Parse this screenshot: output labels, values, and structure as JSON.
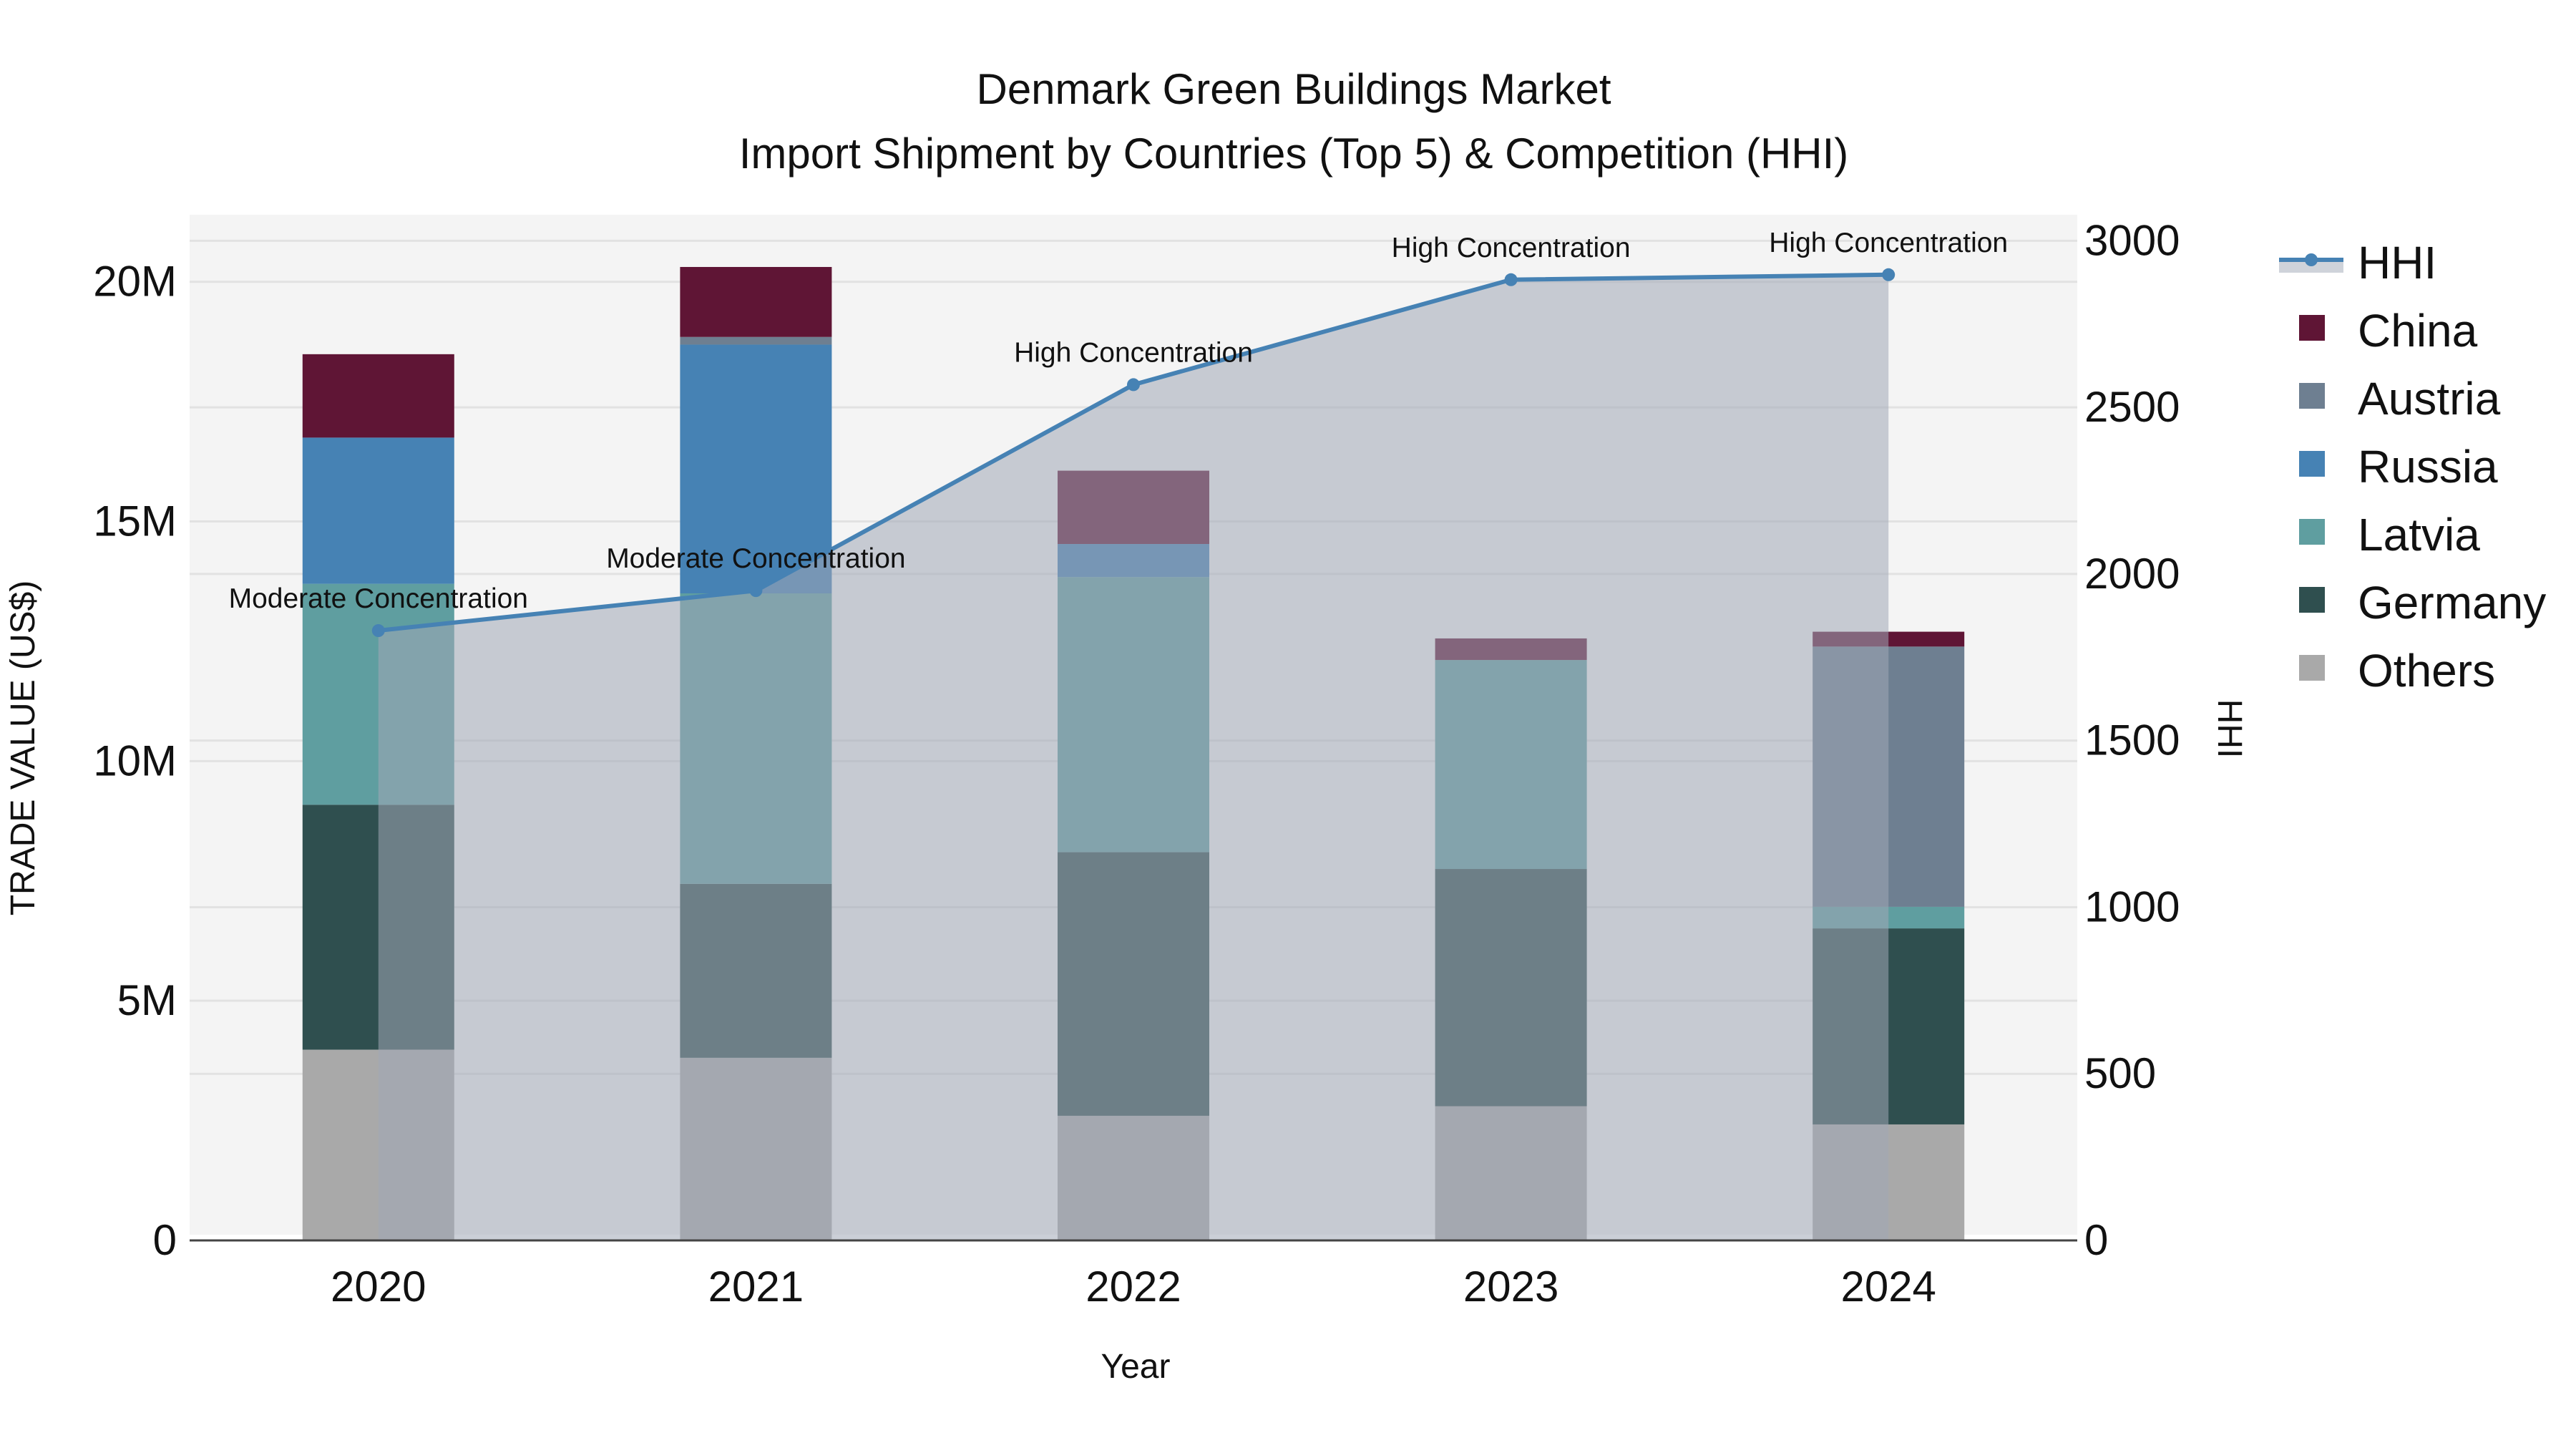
{
  "chart_data": {
    "type": "bar",
    "stacked": true,
    "title": "Denmark Green Buildings Market",
    "subtitle": "Import Shipment by Countries (Top 5) & Competition (HHI)",
    "xlabel": "Year",
    "ylabel": "TRADE VALUE (US$)",
    "y2label": "HHI",
    "categories": [
      "2020",
      "2021",
      "2022",
      "2023",
      "2024"
    ],
    "ylim": [
      0,
      21.4
    ],
    "y_unit": "M US$",
    "yticks": [
      {
        "v": 0,
        "label": "0"
      },
      {
        "v": 5,
        "label": "5M"
      },
      {
        "v": 10,
        "label": "10M"
      },
      {
        "v": 15,
        "label": "15M"
      },
      {
        "v": 20,
        "label": "20M"
      }
    ],
    "y2lim": [
      0,
      3078
    ],
    "y2ticks": [
      {
        "v": 0,
        "label": "0"
      },
      {
        "v": 500,
        "label": "500"
      },
      {
        "v": 1000,
        "label": "1000"
      },
      {
        "v": 1500,
        "label": "1500"
      },
      {
        "v": 2000,
        "label": "2000"
      },
      {
        "v": 2500,
        "label": "2500"
      },
      {
        "v": 3000,
        "label": "3000"
      }
    ],
    "series": [
      {
        "name": "Others",
        "color": "#a9a9a9",
        "values": [
          3.98,
          3.81,
          2.6,
          2.8,
          2.42
        ]
      },
      {
        "name": "Germany",
        "color": "#2f4f4f",
        "values": [
          5.11,
          3.63,
          5.5,
          4.95,
          4.09
        ]
      },
      {
        "name": "Latvia",
        "color": "#5f9ea0",
        "values": [
          4.61,
          6.06,
          5.74,
          4.36,
          0.45
        ]
      },
      {
        "name": "Russia",
        "color": "#4682b4",
        "values": [
          3.05,
          5.19,
          0.69,
          0,
          0
        ]
      },
      {
        "name": "Austria",
        "color": "#6e7f91",
        "values": [
          0,
          0.16,
          0,
          0,
          5.43
        ]
      },
      {
        "name": "China",
        "color": "#5f1535",
        "values": [
          1.74,
          1.46,
          1.53,
          0.45,
          0.31
        ]
      }
    ],
    "hhi": {
      "name": "HHI",
      "color": "#4682b4",
      "values": [
        1830,
        1950,
        2568,
        2883,
        2898
      ],
      "annotations": [
        "Moderate Concentration",
        "Moderate Concentration",
        "High Concentration",
        "High Concentration",
        "High Concentration"
      ]
    },
    "legend_order": [
      "HHI",
      "China",
      "Austria",
      "Russia",
      "Latvia",
      "Germany",
      "Others"
    ],
    "legend_placement": "right",
    "grid": true
  }
}
